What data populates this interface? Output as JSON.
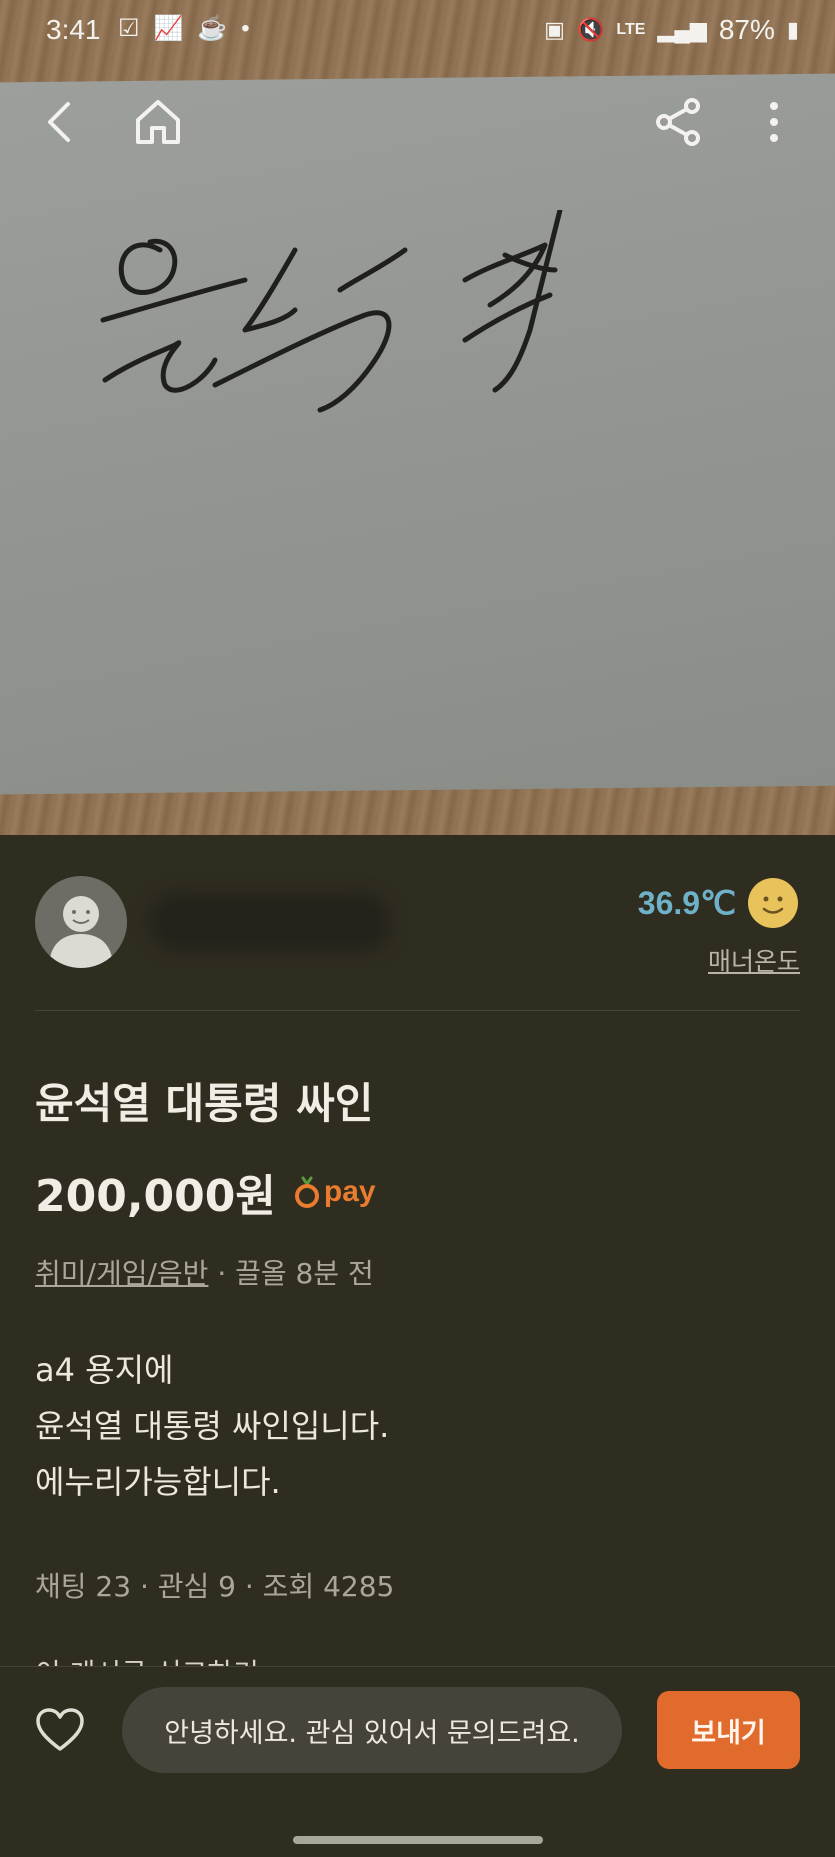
{
  "status_bar": {
    "time": "3:41",
    "battery": "87%",
    "network": "LTE",
    "icons": [
      "check-icon",
      "chart-icon",
      "coffee-icon",
      "dot-icon",
      "battery-saver-icon",
      "mute-icon",
      "lte-icon",
      "signal-icon",
      "battery-icon"
    ]
  },
  "nav": {
    "icons": [
      "back-icon",
      "home-icon",
      "share-icon",
      "more-icon"
    ]
  },
  "seller": {
    "temperature": "36.9℃",
    "manner_label": "매너온도"
  },
  "post": {
    "title": "윤석열 대통령 싸인",
    "price": "200,000원",
    "pay_label": "pay",
    "category": "취미/게임/음반",
    "meta_suffix": " · 끌올 8분 전",
    "description_lines": [
      "a4 용지에",
      "윤석열 대통령 싸인입니다.",
      "에누리가능합니다."
    ],
    "stats": "채팅 23 · 관심 9 · 조회 4285",
    "report_link": "이 게시글 신고하기"
  },
  "bottom_bar": {
    "chat_placeholder": "안녕하세요. 관심 있어서 문의드려요.",
    "send_label": "보내기"
  },
  "colors": {
    "background": "#2f2c20",
    "temperature": "#6fb1c8",
    "accent": "#e06b2c"
  }
}
